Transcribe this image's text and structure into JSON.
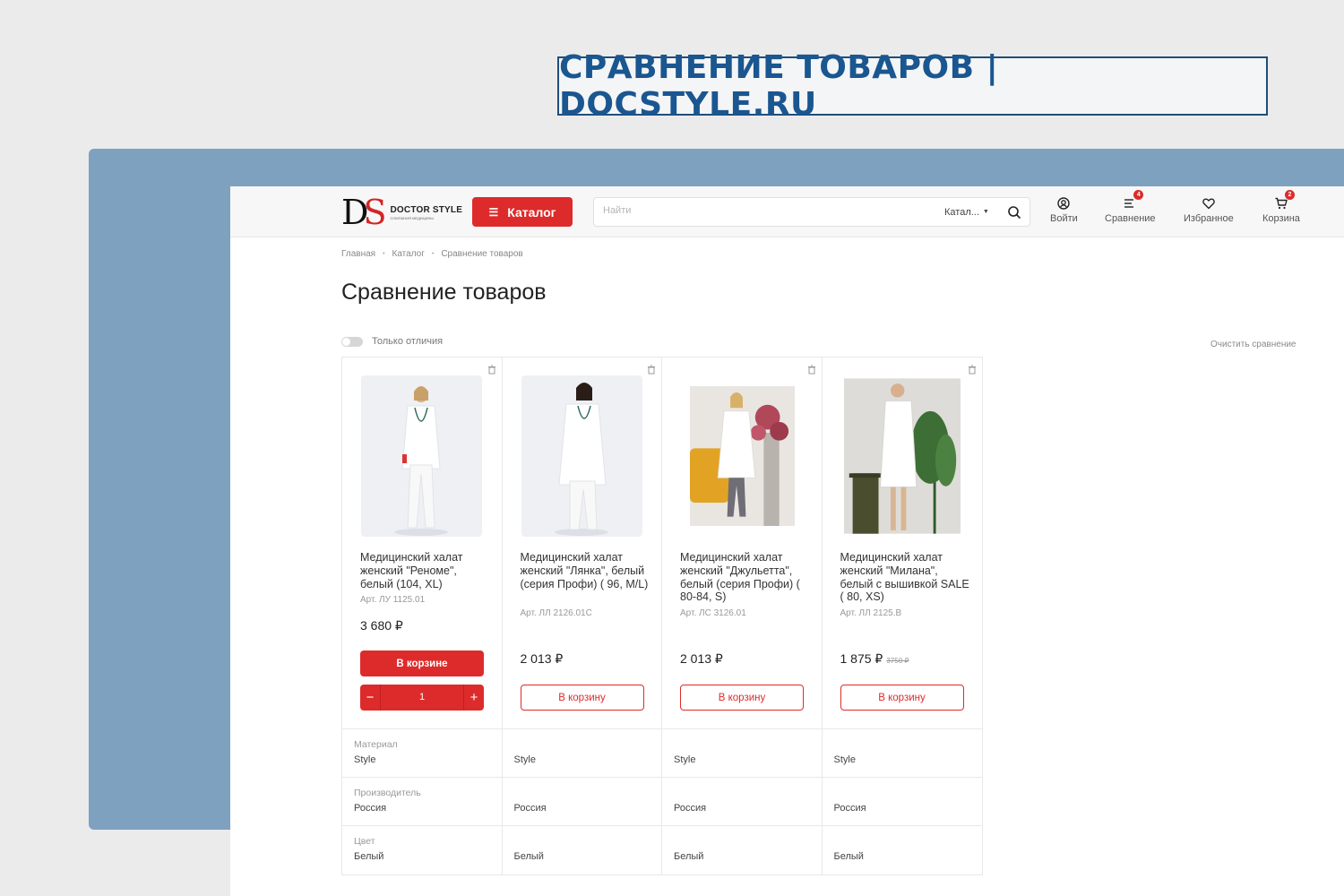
{
  "banner": {
    "title": "СРАВНЕНИЕ ТОВАРОВ | DOCSTYLE.RU"
  },
  "header": {
    "logo": {
      "mark_d": "D",
      "mark_s": "S",
      "name": "DOCTOR STYLE",
      "tagline": "СОМПАНИЯ МЕДИЦИНЫ"
    },
    "catalog_label": "Каталог",
    "search": {
      "placeholder": "Найти",
      "scope": "Катал..."
    },
    "nav": [
      {
        "label": "Войти",
        "icon": "user-circle-icon"
      },
      {
        "label": "Сравнение",
        "icon": "compare-list-icon",
        "badge": "4"
      },
      {
        "label": "Избранное",
        "icon": "heart-icon"
      },
      {
        "label": "Корзина",
        "icon": "cart-icon",
        "badge": "2"
      }
    ]
  },
  "breadcrumb": [
    "Главная",
    "Каталог",
    "Сравнение товаров"
  ],
  "page_title": "Сравнение товаров",
  "only_diff_label": "Только отличия",
  "clear_label": "Очистить сравнение",
  "products": [
    {
      "name": "Медицинский халат женский \"Реноме\", белый (104, XL)",
      "article": "Арт. ЛУ 1125.01",
      "price": "3 680 ₽",
      "old_price": "",
      "in_cart": true,
      "cart_label": "В корзине",
      "qty": "1",
      "minus": "−",
      "plus": "+"
    },
    {
      "name": "Медицинский халат женский \"Лянка\", белый (серия Профи) ( 96, M/L)",
      "article": "Арт. ЛЛ 2126.01C",
      "price": "2 013 ₽",
      "old_price": "",
      "in_cart": false,
      "cart_label": "В корзину"
    },
    {
      "name": "Медицинский халат женский \"Джульетта\", белый (серия Профи) ( 80-84, S)",
      "article": "Арт. ЛС 3126.01",
      "price": "2 013 ₽",
      "old_price": "",
      "in_cart": false,
      "cart_label": "В корзину"
    },
    {
      "name": "Медицинский халат женский \"Милана\", белый с вышивкой SALE ( 80, XS)",
      "article": "Арт. ЛЛ 2125.В",
      "price": "1 875 ₽",
      "old_price": "3750 ₽",
      "in_cart": false,
      "cart_label": "В корзину"
    }
  ],
  "properties": [
    {
      "label": "Материал",
      "values": [
        "Style",
        "Style",
        "Style",
        "Style"
      ]
    },
    {
      "label": "Производитель",
      "values": [
        "Россия",
        "Россия",
        "Россия",
        "Россия"
      ]
    },
    {
      "label": "Цвет",
      "values": [
        "Белый",
        "Белый",
        "Белый",
        "Белый"
      ]
    }
  ],
  "colors": {
    "accent": "#dd2b2b",
    "banner_text": "#1a5690",
    "panel": "#7fa1c0"
  }
}
